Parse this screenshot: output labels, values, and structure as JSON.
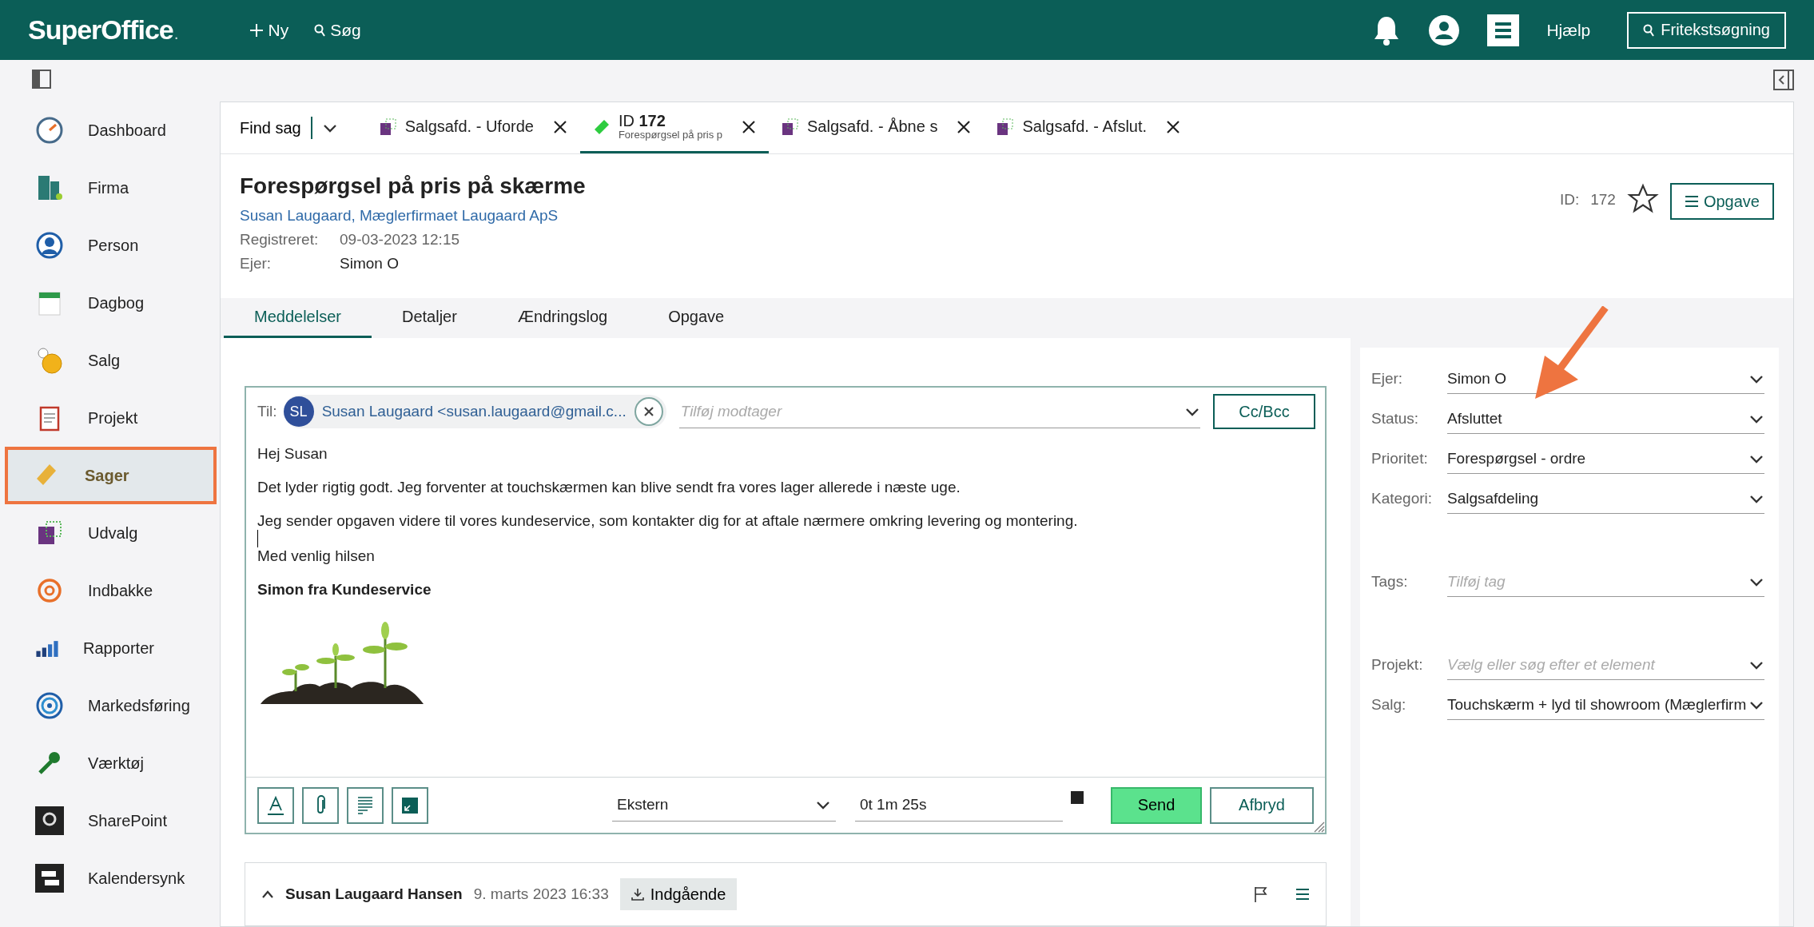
{
  "topbar": {
    "logo": "SuperOffice",
    "logo_mark": ".",
    "new_label": "Ny",
    "search_label": "Søg",
    "help": "Hjælp",
    "freetext": "Fritekstsøgning"
  },
  "sidebar": {
    "items": [
      {
        "label": "Dashboard",
        "selected": false
      },
      {
        "label": "Firma",
        "selected": false
      },
      {
        "label": "Person",
        "selected": false
      },
      {
        "label": "Dagbog",
        "selected": false
      },
      {
        "label": "Salg",
        "selected": false
      },
      {
        "label": "Projekt",
        "selected": false
      },
      {
        "label": "Sager",
        "selected": true
      },
      {
        "label": "Udvalg",
        "selected": false
      },
      {
        "label": "Indbakke",
        "selected": false
      },
      {
        "label": "Rapporter",
        "selected": false
      },
      {
        "label": "Markedsføring",
        "selected": false
      },
      {
        "label": "Værktøj",
        "selected": false
      },
      {
        "label": "SharePoint",
        "selected": false
      },
      {
        "label": "Kalendersynk",
        "selected": false
      }
    ]
  },
  "tabs": {
    "find": "Find sag",
    "items": [
      {
        "kind": "selection",
        "label": "Salgsafd. - Uforde",
        "selected": false
      },
      {
        "kind": "ticket",
        "label": "ID **172**",
        "sublabel": "Forespørgsel på pris p",
        "selected": true
      },
      {
        "kind": "selection",
        "label": "Salgsafd. - Åbne s",
        "selected": false
      },
      {
        "kind": "selection",
        "label": "Salgsafd. - Afslut.",
        "selected": false
      }
    ]
  },
  "ticket": {
    "title": "Forespørgsel på pris på skærme",
    "contact": "Susan Laugaard, Mæglerfirmaet Laugaard ApS",
    "registered_label": "Registreret:",
    "registered": "09-03-2023 12:15",
    "owner_label": "Ejer:",
    "owner": "Simon O",
    "id_label": "ID:",
    "id": "172",
    "favorite": false,
    "task_button": "Opgave"
  },
  "subtabs": [
    {
      "label": "Meddelelser",
      "selected": true
    },
    {
      "label": "Detaljer",
      "selected": false
    },
    {
      "label": "Ændringslog",
      "selected": false
    },
    {
      "label": "Opgave",
      "selected": false
    }
  ],
  "composer": {
    "to_label": "Til:",
    "recipient_initials": "SL",
    "recipient": "Susan Laugaard <susan.laugaard@gmail.c...",
    "add_placeholder": "Tilføj modtager",
    "cc_button": "Cc/Bcc",
    "body": [
      {
        "kind": "text",
        "text": "Hej Susan"
      },
      {
        "kind": "text",
        "text": "Det lyder rigtig godt. Jeg forventer at touchskærmen kan blive sendt fra vores lager allerede i næste uge."
      },
      {
        "kind": "text",
        "text": "Jeg sender opgaven videre til vores kundeservice, som kontakter dig for at aftale nærmere omkring levering og montering."
      },
      {
        "kind": "cursor"
      },
      {
        "kind": "text",
        "text": "Med venlig hilsen"
      },
      {
        "kind": "signature",
        "text": "Simon fra Kundeservice"
      }
    ],
    "visibility": "Ekstern",
    "timer": "0t 1m 25s",
    "send": "Send",
    "cancel": "Afbryd"
  },
  "message": {
    "sender": "Susan Laugaard Hansen",
    "date": "9. marts 2023 16:33",
    "direction": "Indgående",
    "expanded": true
  },
  "field_groups": [
    [
      {
        "label": "Ejer:",
        "value": "Simon O"
      },
      {
        "label": "Status:",
        "value": "Afsluttet"
      },
      {
        "label": "Prioritet:",
        "value": "Forespørgsel - ordre"
      },
      {
        "label": "Kategori:",
        "value": "Salgsafdeling"
      }
    ],
    [
      {
        "label": "Tags:",
        "placeholder": "Tilføj tag"
      }
    ],
    [
      {
        "label": "Projekt:",
        "placeholder": "Vælg eller søg efter et element"
      },
      {
        "label": "Salg:",
        "value": "Touchskærm + lyd til showroom (Mæglerfirm"
      }
    ]
  ]
}
